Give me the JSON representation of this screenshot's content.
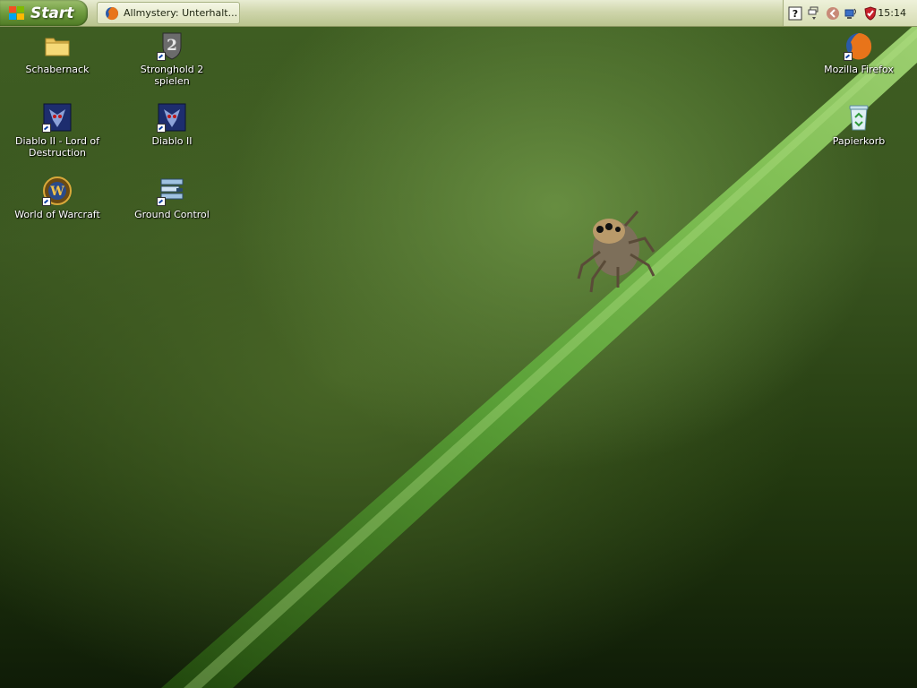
{
  "taskbar": {
    "start_label": "Start",
    "task_window_title": "Allmystery: Unterhalt...",
    "clock": "15:14"
  },
  "desktop_icons": [
    {
      "label": "Schabernack",
      "icon": "folder-icon"
    },
    {
      "label": "Stronghold 2 spielen",
      "icon": "stronghold-shield-icon"
    },
    {
      "label": "Diablo II - Lord of Destruction",
      "icon": "diablo-icon"
    },
    {
      "label": "Diablo II",
      "icon": "diablo-icon"
    },
    {
      "label": "World of Warcraft",
      "icon": "warcraft-icon"
    },
    {
      "label": "Ground Control",
      "icon": "ground-control-icon"
    },
    {
      "label": "Mozilla Firefox",
      "icon": "firefox-icon"
    },
    {
      "label": "Papierkorb",
      "icon": "recycle-bin-icon"
    }
  ],
  "tray_icons": [
    "help-icon",
    "network-toggle-icon",
    "collapse-arrow-icon",
    "network-connection-icon",
    "security-shield-icon"
  ],
  "colors": {
    "accent_green": "#6e9a3e",
    "taskbar": "#cfd6ac",
    "wallpaper": "#3a5620"
  }
}
